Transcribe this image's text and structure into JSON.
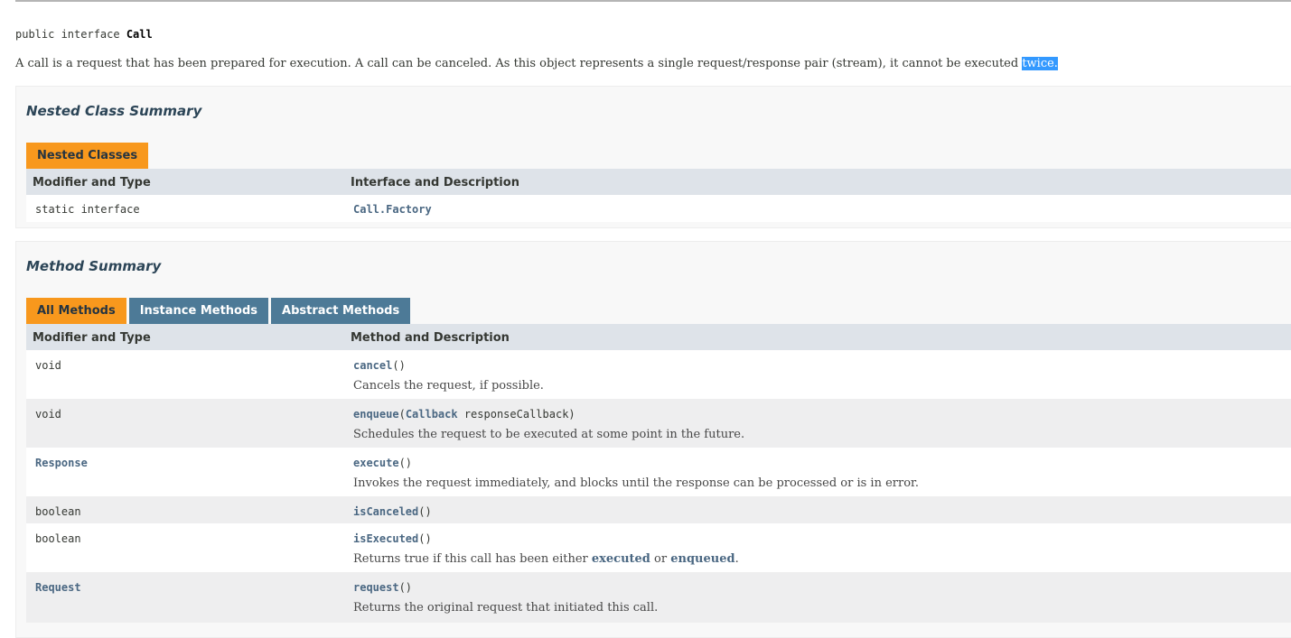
{
  "declaration": {
    "prefix": "public interface ",
    "name": "Call"
  },
  "description": {
    "text": "A call is a request that has been prepared for execution. A call can be canceled. As this object represents a single request/response pair (stream), it cannot be executed ",
    "highlighted": "twice."
  },
  "nested": {
    "title": "Nested Class Summary",
    "tab": "Nested Classes",
    "col1": "Modifier and Type",
    "col2": "Interface and Description",
    "rows": [
      {
        "type": "static interface",
        "name": "Call.Factory"
      }
    ]
  },
  "methods": {
    "title": "Method Summary",
    "tabs": [
      "All Methods",
      "Instance Methods",
      "Abstract Methods"
    ],
    "col1": "Modifier and Type",
    "col2": "Method and Description",
    "rows": [
      {
        "type": "void",
        "name": "cancel",
        "params": "()",
        "desc": "Cancels the request, if possible."
      },
      {
        "type": "void",
        "name": "enqueue",
        "param_open": "(",
        "param_type": "Callback",
        "param_rest": " responseCallback)",
        "desc": "Schedules the request to be executed at some point in the future."
      },
      {
        "type": "Response",
        "name": "execute",
        "params": "()",
        "desc": "Invokes the request immediately, and blocks until the response can be processed or is in error."
      },
      {
        "type": "boolean",
        "name": "isCanceled",
        "params": "()"
      },
      {
        "type": "boolean",
        "name": "isExecuted",
        "params": "()",
        "desc_pre": "Returns true if this call has been either ",
        "link1": "executed",
        "desc_mid": " or ",
        "link2": "enqueued",
        "desc_post": "."
      },
      {
        "type": "Request",
        "name": "request",
        "params": "()",
        "desc": "Returns the original request that initiated this call."
      }
    ]
  }
}
